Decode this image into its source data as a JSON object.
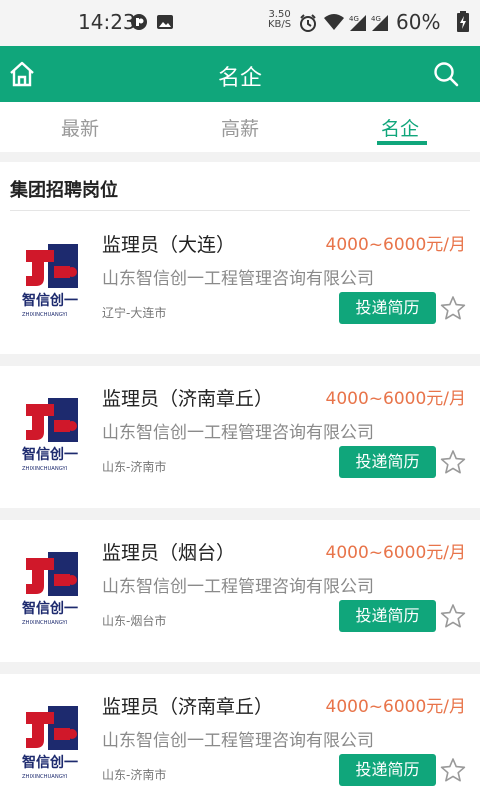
{
  "status_bar": {
    "time": "14:23",
    "net_speed_value": "3.50",
    "net_speed_unit": "KB/S",
    "signal_1_label": "4G",
    "signal_2_label": "4G",
    "battery": "60%"
  },
  "app_bar": {
    "title": "名企"
  },
  "tabs": [
    {
      "label": "最新",
      "active": false
    },
    {
      "label": "高薪",
      "active": false
    },
    {
      "label": "名企",
      "active": true
    }
  ],
  "section": {
    "title": "集团招聘岗位"
  },
  "logo": {
    "brand_cn": "智信创一",
    "brand_en": "ZHIXINCHUANGYI"
  },
  "jobs": [
    {
      "title": "监理员（大连）",
      "salary": "4000~6000元/月",
      "company": "山东智信创一工程管理咨询有限公司",
      "location": "辽宁-大连市",
      "apply_label": "投递简历"
    },
    {
      "title": "监理员（济南章丘）",
      "salary": "4000~6000元/月",
      "company": "山东智信创一工程管理咨询有限公司",
      "location": "山东-济南市",
      "apply_label": "投递简历"
    },
    {
      "title": "监理员（烟台）",
      "salary": "4000~6000元/月",
      "company": "山东智信创一工程管理咨询有限公司",
      "location": "山东-烟台市",
      "apply_label": "投递简历"
    },
    {
      "title": "监理员（济南章丘）",
      "salary": "4000~6000元/月",
      "company": "山东智信创一工程管理咨询有限公司",
      "location": "山东-济南市",
      "apply_label": "投递简历"
    }
  ],
  "colors": {
    "accent": "#10a67b",
    "salary": "#e8744a",
    "logo_red": "#d0182a",
    "logo_navy": "#1d2a6e"
  },
  "icons": {
    "home": "home-icon",
    "search": "search-icon",
    "star": "star-outline-icon"
  }
}
